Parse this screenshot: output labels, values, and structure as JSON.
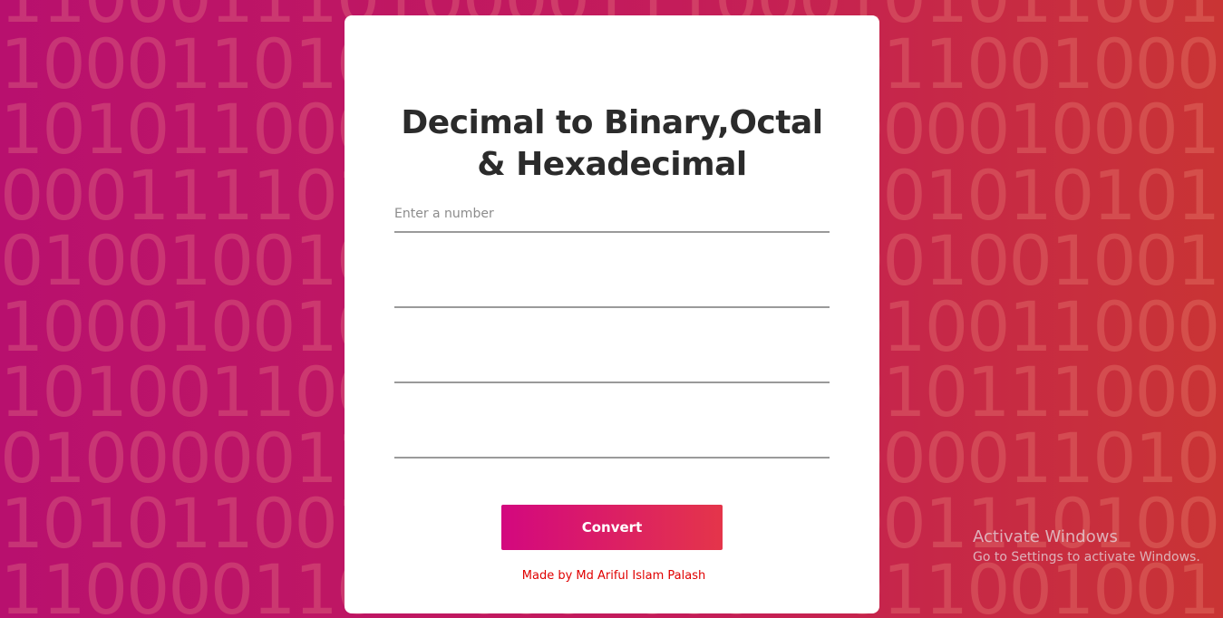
{
  "background": {
    "binary_rows": [
      "1100011101000011100010101100101011",
      "1000110101011100101001100100001010",
      "1010110000101110100100001000100110",
      "0001111010001100110110101010101000",
      "0100100100010110011100100100101011",
      "1000100100100111110101001100011000",
      "1010011001100110100101011100001110",
      "0100000111010001000100001101000011",
      "1010110011000101000100111010011100",
      "1100001101100010001101100100110010"
    ],
    "gradient_colors": [
      "#b8106e",
      "#c93434"
    ]
  },
  "card": {
    "title_line1": "Decimal to Binary,Octal",
    "title_line2": "& Hexadecimal",
    "input": {
      "placeholder": "Enter a number",
      "value": ""
    },
    "outputs": [
      {
        "value": ""
      },
      {
        "value": ""
      },
      {
        "value": ""
      }
    ],
    "convert_label": "Convert",
    "credit": "Made by Md Ariful Islam Palash"
  },
  "watermark": {
    "title": "Activate Windows",
    "subtitle": "Go to Settings to activate Windows."
  },
  "colors": {
    "button_start": "#d3087f",
    "button_end": "#e4354a",
    "credit": "#e00000",
    "title": "#2b2b2b"
  }
}
